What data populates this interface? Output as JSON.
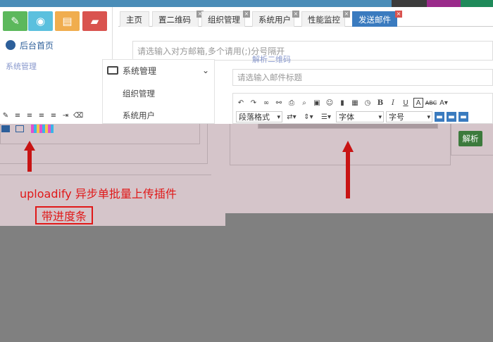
{
  "toolbar": {
    "buttons": [
      {
        "name": "edit-button",
        "icon": "pencil-icon",
        "glyph": "✎",
        "color": "#5cb85c"
      },
      {
        "name": "view-button",
        "icon": "eye-icon",
        "glyph": "◉",
        "color": "#5bc0de"
      },
      {
        "name": "book-button",
        "icon": "book-icon",
        "glyph": "▤",
        "color": "#f0ad4e"
      },
      {
        "name": "folder-button",
        "icon": "folder-icon",
        "glyph": "▰",
        "color": "#d9534f"
      }
    ]
  },
  "sidebar": {
    "home_label": "后台首页",
    "ghost_label": "系统管理"
  },
  "tabs": [
    {
      "label": "主页",
      "closable": false
    },
    {
      "label": "置二维码",
      "closable": true
    },
    {
      "label": "组织管理",
      "closable": true
    },
    {
      "label": "系统用户",
      "closable": true
    },
    {
      "label": "性能监控",
      "closable": true
    },
    {
      "label": "发送邮件",
      "closable": true,
      "active": true
    }
  ],
  "mail": {
    "recipient_placeholder": "请选输入对方邮箱,多个请用(;)分号隔开",
    "subject_placeholder": "请选输入邮件标题",
    "ghost_tab": "解析二维码"
  },
  "dropdown": {
    "header": "系统管理",
    "items": [
      "组织管理",
      "系统用户"
    ]
  },
  "editor": {
    "paragraph_format": "段落格式",
    "font_family": "字体",
    "font_size": "字号"
  },
  "annotation": {
    "main": "uploadify 异步单批量上传插件",
    "sub": "带进度条"
  },
  "parse_button": "解析",
  "colors": {
    "accent": "#3a7bbf",
    "annotation_red": "#e01818",
    "pink_bg": "#d5c5ca",
    "gray_bg": "#808080"
  }
}
